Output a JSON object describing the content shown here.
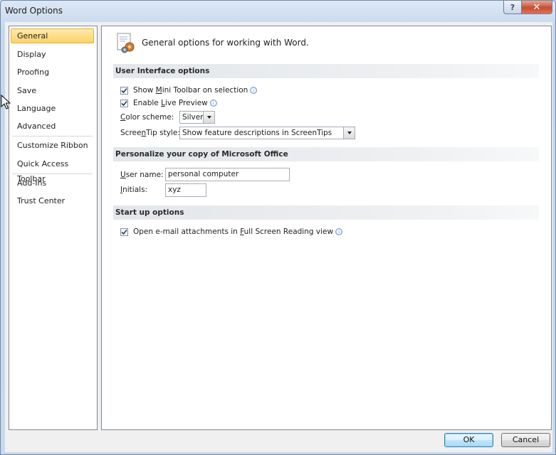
{
  "window": {
    "title": "Word Options",
    "help_glyph": "?",
    "close_glyph": "✕"
  },
  "nav": {
    "items": [
      {
        "label": "General",
        "selected": true
      },
      {
        "label": "Display"
      },
      {
        "label": "Proofing"
      },
      {
        "label": "Save"
      },
      {
        "label": "Language"
      },
      {
        "label": "Advanced"
      },
      {
        "label": "Customize Ribbon"
      },
      {
        "label": "Quick Access Toolbar"
      },
      {
        "label": "Add-Ins"
      },
      {
        "label": "Trust Center"
      }
    ]
  },
  "main": {
    "header": "General options for working with Word.",
    "sections": {
      "ui": {
        "title": "User Interface options",
        "mini_toolbar": {
          "pre": "Show ",
          "key": "M",
          "post": "ini Toolbar on selection",
          "checked": true
        },
        "live_preview": {
          "pre": "Enable ",
          "key": "L",
          "post": "ive Preview",
          "checked": true
        },
        "color_scheme": {
          "label_key": "C",
          "label_rest": "olor scheme:",
          "value": "Silver"
        },
        "screentip": {
          "label_pre": "Scree",
          "label_key": "n",
          "label_post": "Tip style:",
          "value": "Show feature descriptions in ScreenTips"
        }
      },
      "personalize": {
        "title": "Personalize your copy of Microsoft Office",
        "user_name": {
          "label_key": "U",
          "label_rest": "ser name:",
          "value": "personal computer"
        },
        "initials": {
          "label_key": "I",
          "label_rest": "nitials:",
          "value": "xyz"
        }
      },
      "startup": {
        "title": "Start up options",
        "fullscreen": {
          "pre": "Open e-mail attachments in ",
          "key": "F",
          "post": "ull Screen Reading view",
          "checked": true
        }
      }
    }
  },
  "footer": {
    "ok": "OK",
    "cancel": "Cancel"
  },
  "icons": {
    "info": "ⓘ"
  }
}
